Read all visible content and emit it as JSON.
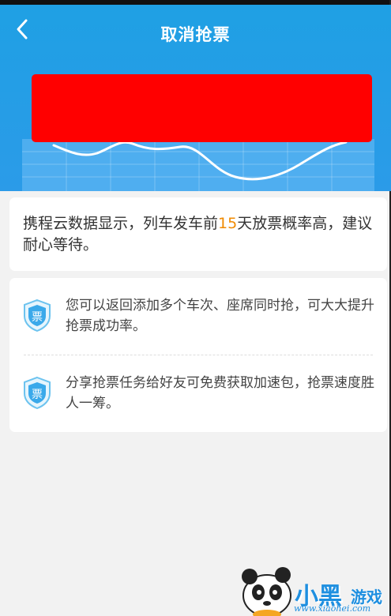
{
  "header": {
    "title": "取消抢票",
    "back_icon": "chevron-left-icon",
    "background": "#1fa0e4"
  },
  "notice": {
    "text_before": "携程云数据显示，列车发车前",
    "days": "15",
    "text_after": "天放票概率高，建议耐心等待。",
    "highlight_color": "#f08a00"
  },
  "tips": [
    {
      "icon": "ticket-shield-icon",
      "badge_char": "票",
      "text": "您可以返回添加多个车次、座席同时抢，可大大提升抢票成功率。"
    },
    {
      "icon": "ticket-shield-icon",
      "badge_char": "票",
      "text": "分享抢票任务给好友可免费获取加速包，抢票速度胜人一筹。"
    }
  ],
  "watermark": {
    "brand": "小黑",
    "brand_suffix": "游戏",
    "url": "www.xiaohei.com"
  }
}
